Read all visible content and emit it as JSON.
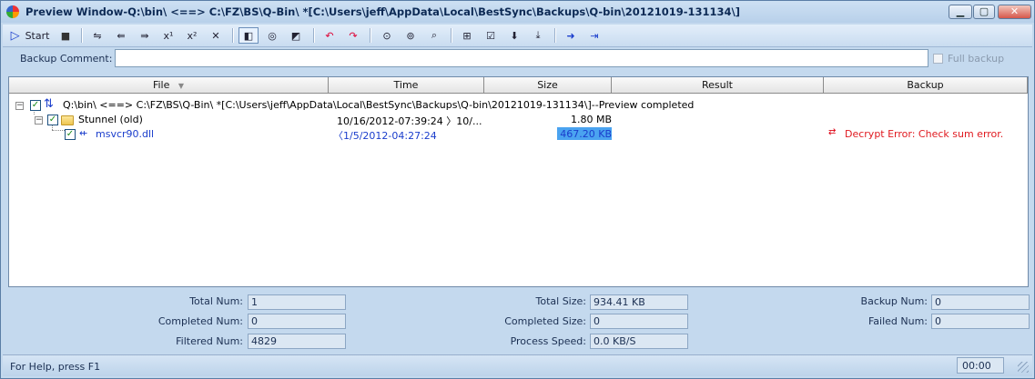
{
  "window": {
    "title": "Preview Window-Q:\\bin\\ <==> C:\\FZ\\BS\\Q-Bin\\ *[C:\\Users\\jeff\\AppData\\Local\\BestSync\\Backups\\Q-bin\\20121019-131134\\]",
    "minimize": "▁",
    "maximize": "▢",
    "close": "✕"
  },
  "toolbar": {
    "start_label": "Start",
    "start_icon": "▷",
    "stop_icon": "■"
  },
  "comment": {
    "label": "Backup Comment:",
    "value": "",
    "full_backup_label": "Full backup"
  },
  "columns": [
    "File",
    "Time",
    "Size",
    "Result",
    "Backup"
  ],
  "rows": [
    {
      "file": "Q:\\bin\\ <==> C:\\FZ\\BS\\Q-Bin\\ *[C:\\Users\\jeff\\AppData\\Local\\BestSync\\Backups\\Q-bin\\20121019-131134\\]--Preview completed",
      "time": "",
      "size": "",
      "result": "",
      "backup": ""
    },
    {
      "file": "Stunnel (old)",
      "time": "10/16/2012-07:39:24 〉10/...",
      "size": "1.80 MB",
      "result": "",
      "backup": ""
    },
    {
      "file": "msvcr90.dll",
      "time": "〈1/5/2012-04:27:24",
      "size": "467.20 KB",
      "result": "",
      "backup": "Decrypt Error: Check sum error."
    }
  ],
  "stats": {
    "total_num_label": "Total Num:",
    "total_num": "1",
    "completed_num_label": "Completed Num:",
    "completed_num": "0",
    "filtered_num_label": "Filtered Num:",
    "filtered_num": "4829",
    "total_size_label": "Total Size:",
    "total_size": "934.41 KB",
    "completed_size_label": "Completed Size:",
    "completed_size": "0",
    "process_speed_label": "Process Speed:",
    "process_speed": "0.0 KB/S",
    "backup_num_label": "Backup Num:",
    "backup_num": "0",
    "failed_num_label": "Failed Num:",
    "failed_num": "0"
  },
  "status": {
    "help": "For Help, press F1",
    "time": "00:00"
  },
  "colors": {
    "accent_blue": "#1a3dcc",
    "error_red": "#e0191f",
    "selection": "#4aa3f0"
  }
}
